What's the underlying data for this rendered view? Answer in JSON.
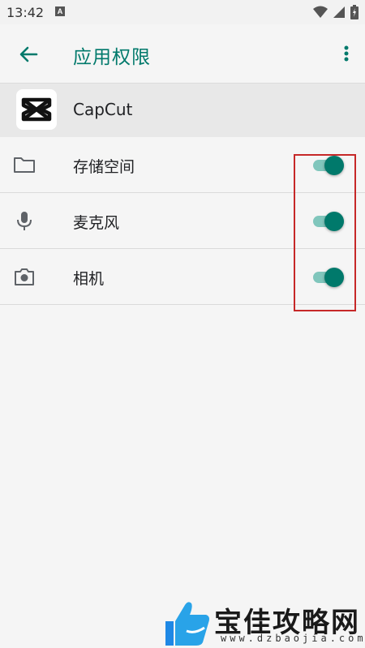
{
  "status_bar": {
    "time": "13:42",
    "notification_badge": "A"
  },
  "app_bar": {
    "title": "应用权限",
    "back_icon": "arrow-left-icon",
    "more_icon": "more-vert-icon",
    "accent_color": "#00796b"
  },
  "app": {
    "name": "CapCut"
  },
  "permissions": [
    {
      "label": "存储空间",
      "icon": "folder-icon",
      "enabled": true
    },
    {
      "label": "麦克风",
      "icon": "microphone-icon",
      "enabled": true
    },
    {
      "label": "相机",
      "icon": "camera-icon",
      "enabled": true
    }
  ],
  "highlight_color": "#c62828",
  "watermark": {
    "title": "宝佳攻略网",
    "url": "www.dzbaojia.com"
  }
}
